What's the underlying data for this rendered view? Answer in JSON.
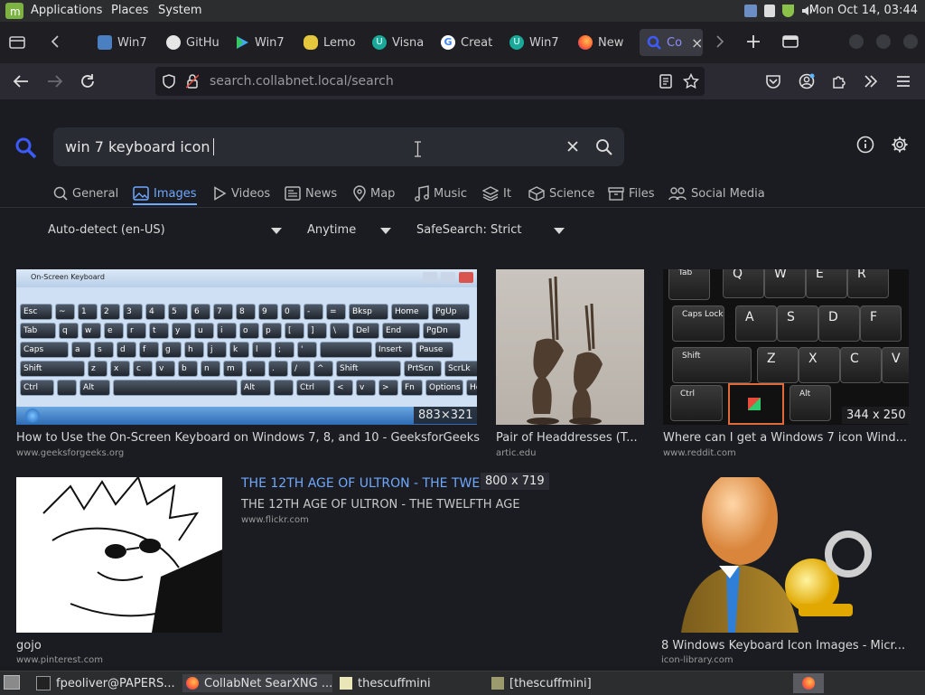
{
  "system_panel": {
    "menus": [
      "Applications",
      "Places",
      "System"
    ],
    "clock": "Mon Oct 14, 03:44"
  },
  "tabs": [
    {
      "label": "Win7",
      "icon": "puzzle-globe-icon"
    },
    {
      "label": "GitHu",
      "icon": "github-icon"
    },
    {
      "label": "Win7",
      "icon": "play-icon"
    },
    {
      "label": "Lemo",
      "icon": "lemon-icon"
    },
    {
      "label": "Visna",
      "icon": "u-icon"
    },
    {
      "label": "Creat",
      "icon": "google-icon"
    },
    {
      "label": "Win7",
      "icon": "u-icon"
    },
    {
      "label": "New",
      "icon": "firefox-icon"
    },
    {
      "label": "Co",
      "icon": "searxng-icon",
      "active": true
    }
  ],
  "navbar": {
    "url": "search.collabnet.local/search"
  },
  "search": {
    "query": "win 7 keyboard icon"
  },
  "categories": [
    "General",
    "Images",
    "Videos",
    "News",
    "Map",
    "Music",
    "It",
    "Science",
    "Files",
    "Social Media"
  ],
  "active_category": "Images",
  "filters": {
    "language": "Auto-detect (en-US)",
    "time": "Anytime",
    "safesearch": "SafeSearch: Strict"
  },
  "results": [
    {
      "title": "How to Use the On-Screen Keyboard on Windows 7, 8, and 10 - GeeksforGeeks",
      "source": "www.geeksforgeeks.org",
      "dims": "883×321"
    },
    {
      "title": "Pair of Headdresses (T...",
      "source": "artic.edu",
      "dims": ""
    },
    {
      "title": "Where can I get a Windows 7 icon Wind...",
      "source": "www.reddit.com",
      "dims": "344 x 250"
    },
    {
      "title": "gojo",
      "source": "www.pinterest.com",
      "dims": ""
    },
    {
      "title": "8 Windows Keyboard Icon Images - Micr...",
      "source": "icon-library.com",
      "dims": ""
    }
  ],
  "detail": {
    "link_title": "THE 12TH AGE OF ULTRON - THE TWE",
    "dims": "800 x 719",
    "title": "THE 12TH AGE OF ULTRON - THE TWELFTH AGE",
    "source": "www.flickr.com"
  },
  "onscreen_keyboard": {
    "window_title": "On-Screen Keyboard",
    "rows": [
      [
        "Esc",
        "~",
        "1",
        "2",
        "3",
        "4",
        "5",
        "6",
        "7",
        "8",
        "9",
        "0",
        "-",
        "=",
        "Bksp",
        "Home",
        "PgUp"
      ],
      [
        "Tab",
        "q",
        "w",
        "e",
        "r",
        "t",
        "y",
        "u",
        "i",
        "o",
        "p",
        "[",
        "]",
        "\\",
        "Del",
        "End",
        "PgDn"
      ],
      [
        "Caps",
        "a",
        "s",
        "d",
        "f",
        "g",
        "h",
        "j",
        "k",
        "l",
        ";",
        "'",
        "",
        "Insert",
        "Pause"
      ],
      [
        "Shift",
        "z",
        "x",
        "c",
        "v",
        "b",
        "n",
        "m",
        ",",
        ".",
        "/",
        "^",
        "Shift",
        "PrtScn",
        "ScrLk"
      ],
      [
        "Ctrl",
        "",
        "Alt",
        "",
        "Alt",
        "",
        "Ctrl",
        "<",
        "v",
        ">",
        "Fn",
        "Options",
        "Help"
      ]
    ]
  },
  "keycaps_photo": {
    "keys": [
      "Tab",
      "Q",
      "W",
      "E",
      "R",
      "Caps Lock",
      "A",
      "S",
      "D",
      "F",
      "Shift",
      "Z",
      "X",
      "C",
      "V",
      "Ctrl",
      "Alt"
    ]
  },
  "taskbar": {
    "items": [
      {
        "label": "fpeoliver@PAPERS...",
        "icon": "terminal-icon"
      },
      {
        "label": "CollabNet SearXNG ...",
        "icon": "firefox-icon",
        "active": true
      },
      {
        "label": "thescuffmini",
        "icon": "notes-icon"
      },
      {
        "label": "[thescuffmini]",
        "icon": "notes-icon"
      }
    ]
  }
}
